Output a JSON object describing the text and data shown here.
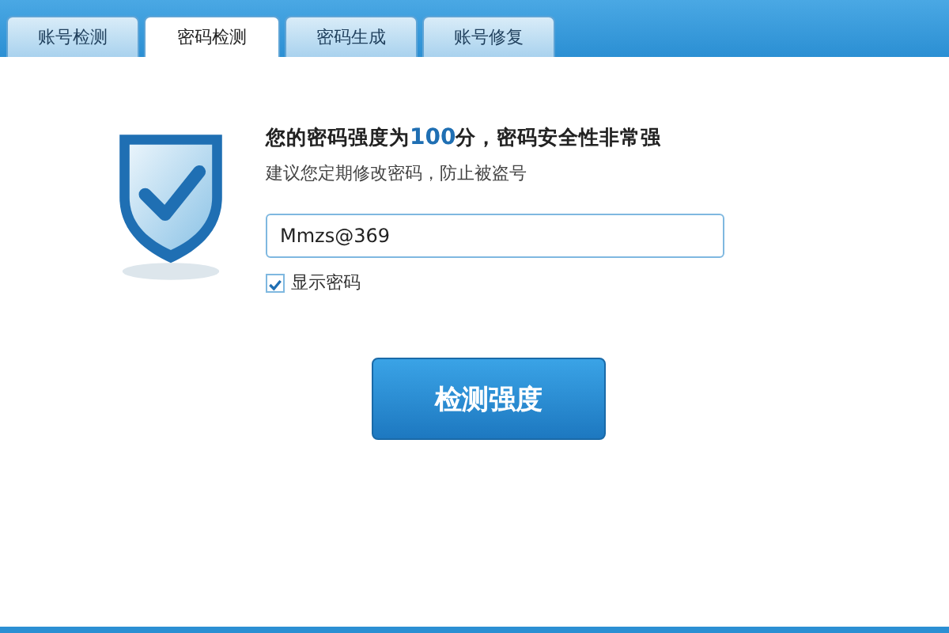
{
  "tabs": [
    {
      "label": "账号检测",
      "selected": false
    },
    {
      "label": "密码检测",
      "selected": true
    },
    {
      "label": "密码生成",
      "selected": false
    },
    {
      "label": "账号修复",
      "selected": false
    }
  ],
  "result": {
    "before": "您的密码强度为",
    "score": "100",
    "after": "分，密码安全性非常强"
  },
  "advice": "建议您定期修改密码，防止被盗号",
  "password": {
    "value": "Mmzs@369"
  },
  "show_password": {
    "label": "显示密码",
    "checked": true
  },
  "buttons": [
    "检测强度"
  ]
}
